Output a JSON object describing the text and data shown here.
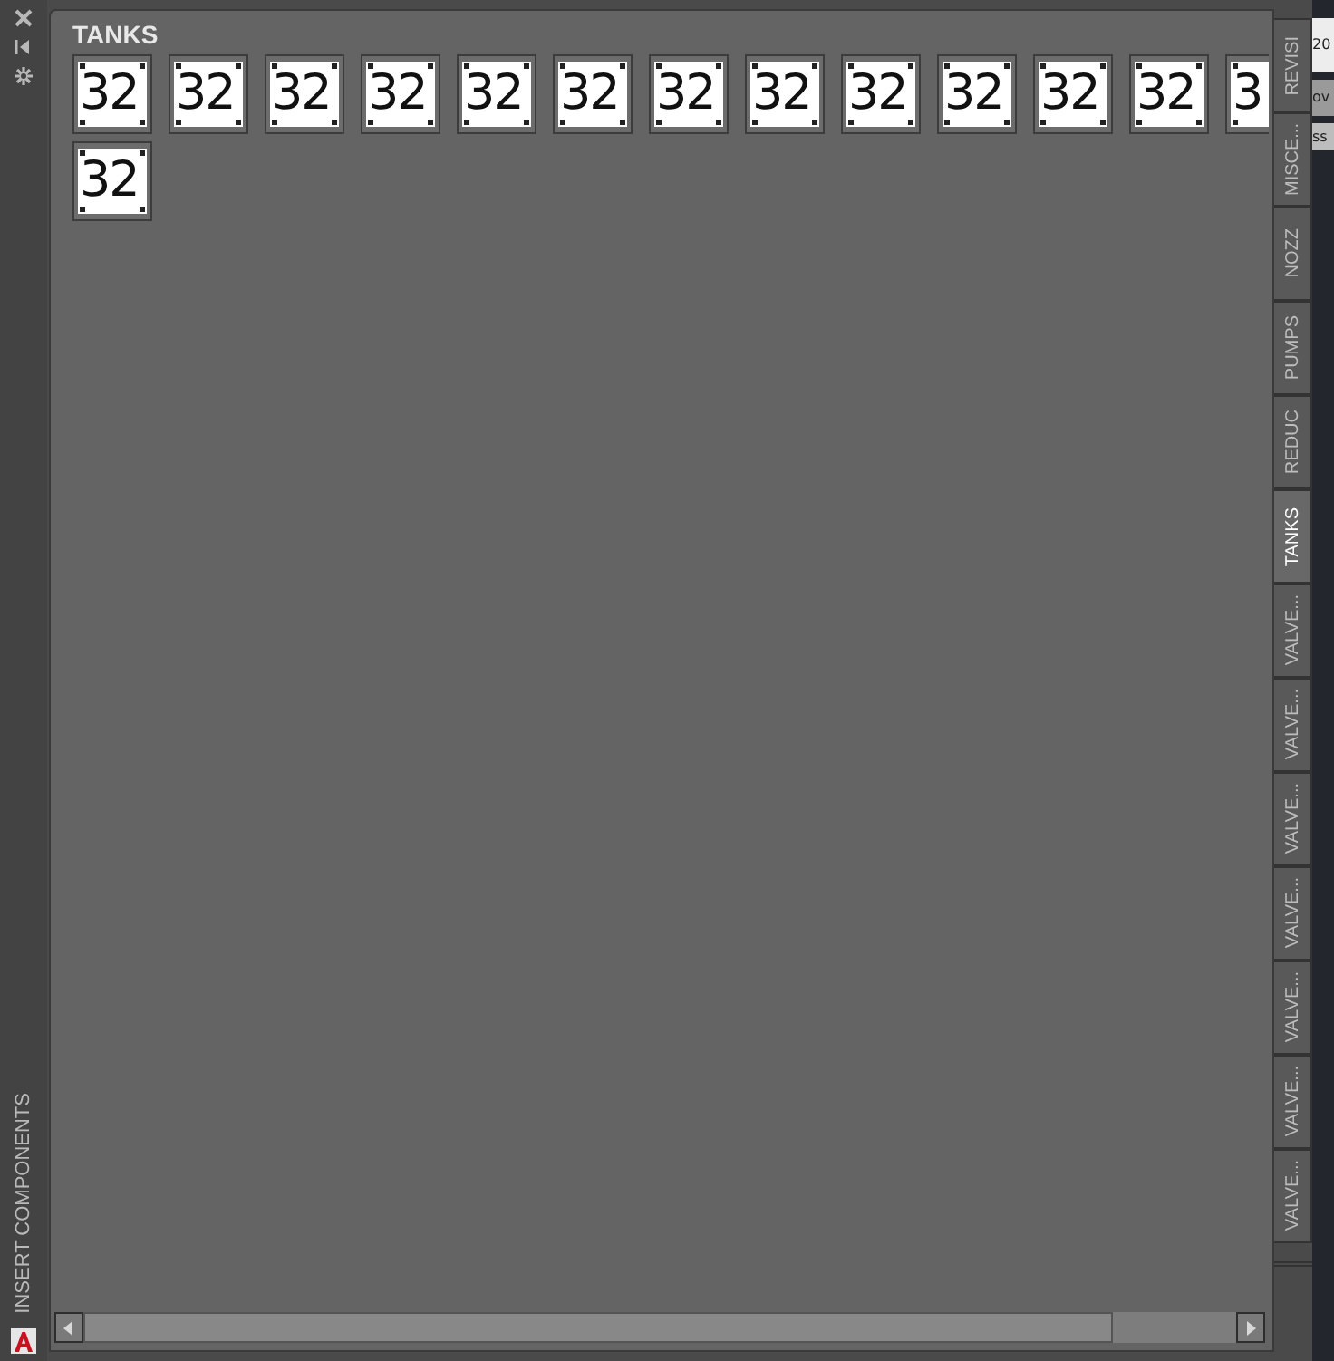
{
  "palette": {
    "side_label": "INSERT COMPONENTS",
    "title": "TANKS",
    "tiles": [
      {
        "label": "32"
      },
      {
        "label": "32"
      },
      {
        "label": "32"
      },
      {
        "label": "32"
      },
      {
        "label": "32"
      },
      {
        "label": "32"
      },
      {
        "label": "32"
      },
      {
        "label": "32"
      },
      {
        "label": "32"
      },
      {
        "label": "32"
      },
      {
        "label": "32"
      },
      {
        "label": "32"
      },
      {
        "label": "3"
      },
      {
        "label": "32"
      }
    ],
    "tabs": [
      {
        "label": "REVISI",
        "selected": false
      },
      {
        "label": "MISCE...",
        "selected": false
      },
      {
        "label": "NOZZ",
        "selected": false
      },
      {
        "label": "PUMPS",
        "selected": false
      },
      {
        "label": "REDUC",
        "selected": false
      },
      {
        "label": "TANKS",
        "selected": true
      },
      {
        "label": "VALVE...",
        "selected": false
      },
      {
        "label": "VALVE...",
        "selected": false
      },
      {
        "label": "VALVE...",
        "selected": false
      },
      {
        "label": "VALVE...",
        "selected": false
      },
      {
        "label": "VALVE...",
        "selected": false
      },
      {
        "label": "VALVE...",
        "selected": false
      },
      {
        "label": "VALVE...",
        "selected": false
      }
    ]
  },
  "background": {
    "texts": [
      {
        "label": "20"
      },
      {
        "label": "ov"
      },
      {
        "label": "ss"
      }
    ]
  }
}
